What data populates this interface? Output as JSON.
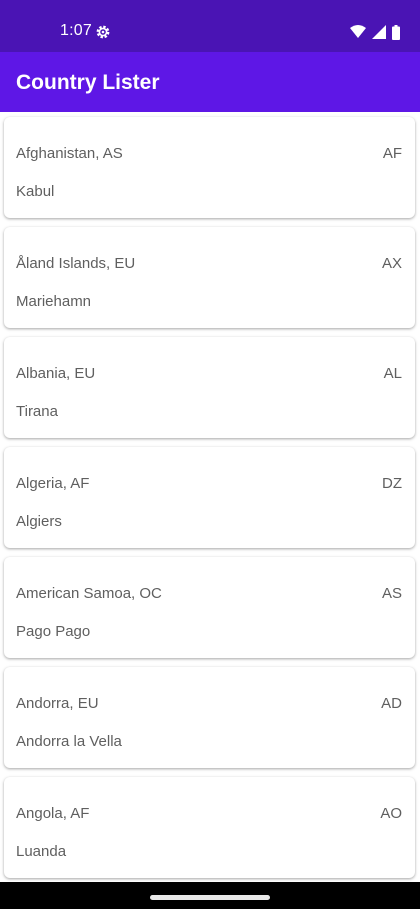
{
  "status_bar": {
    "time": "1:07",
    "settings_icon": "gear-icon",
    "wifi_icon": "wifi-icon",
    "signal_icon": "cellular-signal-icon",
    "battery_icon": "battery-icon"
  },
  "app_bar": {
    "title": "Country Lister",
    "background": "#5e17e6"
  },
  "colors": {
    "status_bar": "#4a14b4",
    "app_bar": "#5e17e6",
    "card_text": "#5f5f5f"
  },
  "countries": [
    {
      "name": "Afghanistan, AS",
      "code": "AF",
      "capital": "Kabul"
    },
    {
      "name": "Åland Islands, EU",
      "code": "AX",
      "capital": "Mariehamn"
    },
    {
      "name": "Albania, EU",
      "code": "AL",
      "capital": "Tirana"
    },
    {
      "name": "Algeria, AF",
      "code": "DZ",
      "capital": "Algiers"
    },
    {
      "name": "American Samoa, OC",
      "code": "AS",
      "capital": "Pago Pago"
    },
    {
      "name": "Andorra, EU",
      "code": "AD",
      "capital": "Andorra la Vella"
    },
    {
      "name": "Angola, AF",
      "code": "AO",
      "capital": "Luanda"
    }
  ]
}
